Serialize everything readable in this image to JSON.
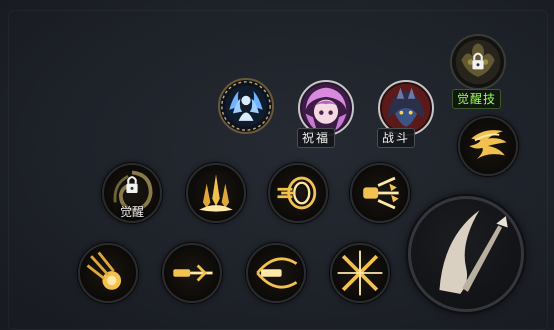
{
  "top_buttons": {
    "blessing_label": "祝福",
    "combat_label": "战斗",
    "awaken_skill_label": "觉醒技"
  },
  "skills": {
    "awaken_label": "觉醒"
  },
  "colors": {
    "skill_gold": "#f2c14e",
    "skill_glow": "#ffe9a8",
    "awaken_green": "#9cff55",
    "blessing_pink": "#d98adf",
    "combat_red": "#b33a34"
  }
}
